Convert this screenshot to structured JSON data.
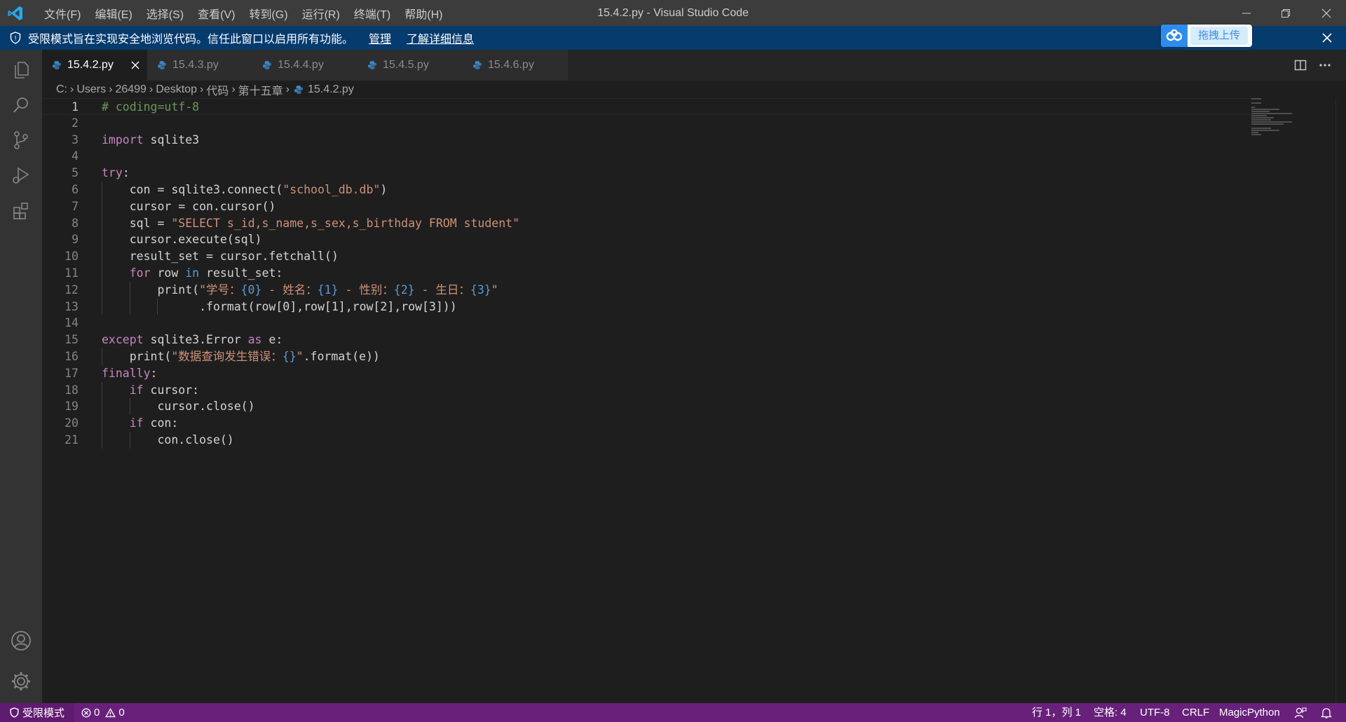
{
  "titlebar": {
    "menu": [
      "文件(F)",
      "编辑(E)",
      "选择(S)",
      "查看(V)",
      "转到(G)",
      "运行(R)",
      "终端(T)",
      "帮助(H)"
    ],
    "window_title": "15.4.2.py - Visual Studio Code"
  },
  "banner": {
    "message": "受限模式旨在实现安全地浏览代码。信任此窗口以启用所有功能。",
    "manage_link": "管理",
    "learn_more_link": "了解详细信息"
  },
  "overlay": {
    "upload_button": "拖拽上传"
  },
  "tabs": [
    {
      "label": "15.4.2.py",
      "active": true
    },
    {
      "label": "15.4.3.py",
      "active": false
    },
    {
      "label": "15.4.4.py",
      "active": false
    },
    {
      "label": "15.4.5.py",
      "active": false
    },
    {
      "label": "15.4.6.py",
      "active": false
    }
  ],
  "breadcrumb": [
    "C:",
    "Users",
    "26499",
    "Desktop",
    "代码",
    "第十五章",
    "15.4.2.py"
  ],
  "editor": {
    "current_line": 1,
    "lines": [
      [
        [
          "t-cm",
          "# coding=utf-8"
        ]
      ],
      [],
      [
        [
          "t-kw",
          "import"
        ],
        [
          "t-id",
          " sqlite3"
        ]
      ],
      [],
      [
        [
          "t-kw",
          "try"
        ],
        [
          "t-id",
          ":"
        ]
      ],
      [
        [
          "t-id",
          "    con = sqlite3.connect("
        ],
        [
          "t-str",
          "\"school_db.db\""
        ],
        [
          "t-id",
          ")"
        ]
      ],
      [
        [
          "t-id",
          "    cursor = con.cursor()"
        ]
      ],
      [
        [
          "t-id",
          "    sql = "
        ],
        [
          "t-str",
          "\"SELECT s_id,s_name,s_sex,s_birthday FROM student\""
        ]
      ],
      [
        [
          "t-id",
          "    cursor.execute(sql)"
        ]
      ],
      [
        [
          "t-id",
          "    result_set = cursor.fetchall()"
        ]
      ],
      [
        [
          "t-id",
          "    "
        ],
        [
          "t-kw",
          "for"
        ],
        [
          "t-id",
          " row "
        ],
        [
          "t-kw2",
          "in"
        ],
        [
          "t-id",
          " result_set:"
        ]
      ],
      [
        [
          "t-id",
          "        print("
        ],
        [
          "t-str",
          "\"学号："
        ],
        [
          "t-fmt",
          "{0}"
        ],
        [
          "t-str",
          " - 姓名："
        ],
        [
          "t-fmt",
          "{1}"
        ],
        [
          "t-str",
          " - 性别："
        ],
        [
          "t-fmt",
          "{2}"
        ],
        [
          "t-str",
          " - 生日："
        ],
        [
          "t-fmt",
          "{3}"
        ],
        [
          "t-str",
          "\""
        ]
      ],
      [
        [
          "t-id",
          "              .format(row["
        ],
        [
          "t-num",
          "0"
        ],
        [
          "t-id",
          "],row["
        ],
        [
          "t-num",
          "1"
        ],
        [
          "t-id",
          "],row["
        ],
        [
          "t-num",
          "2"
        ],
        [
          "t-id",
          "],row["
        ],
        [
          "t-num",
          "3"
        ],
        [
          "t-id",
          "]))"
        ]
      ],
      [],
      [
        [
          "t-kw",
          "except"
        ],
        [
          "t-id",
          " sqlite3.Error "
        ],
        [
          "t-kw",
          "as"
        ],
        [
          "t-id",
          " e:"
        ]
      ],
      [
        [
          "t-id",
          "    print("
        ],
        [
          "t-str",
          "\"数据查询发生错误："
        ],
        [
          "t-fmt",
          "{}"
        ],
        [
          "t-str",
          "\""
        ],
        [
          "t-id",
          ".format(e))"
        ]
      ],
      [
        [
          "t-kw",
          "finally"
        ],
        [
          "t-id",
          ":"
        ]
      ],
      [
        [
          "t-id",
          "    "
        ],
        [
          "t-kw",
          "if"
        ],
        [
          "t-id",
          " cursor:"
        ]
      ],
      [
        [
          "t-id",
          "        cursor.close()"
        ]
      ],
      [
        [
          "t-id",
          "    "
        ],
        [
          "t-kw",
          "if"
        ],
        [
          "t-id",
          " con:"
        ]
      ],
      [
        [
          "t-id",
          "        con.close()"
        ]
      ]
    ]
  },
  "statusbar": {
    "mode": "受限模式",
    "errors": "0",
    "warnings": "0",
    "position": "行 1，列 1",
    "indent": "空格: 4",
    "encoding": "UTF-8",
    "eol": "CRLF",
    "language": "MagicPython"
  }
}
